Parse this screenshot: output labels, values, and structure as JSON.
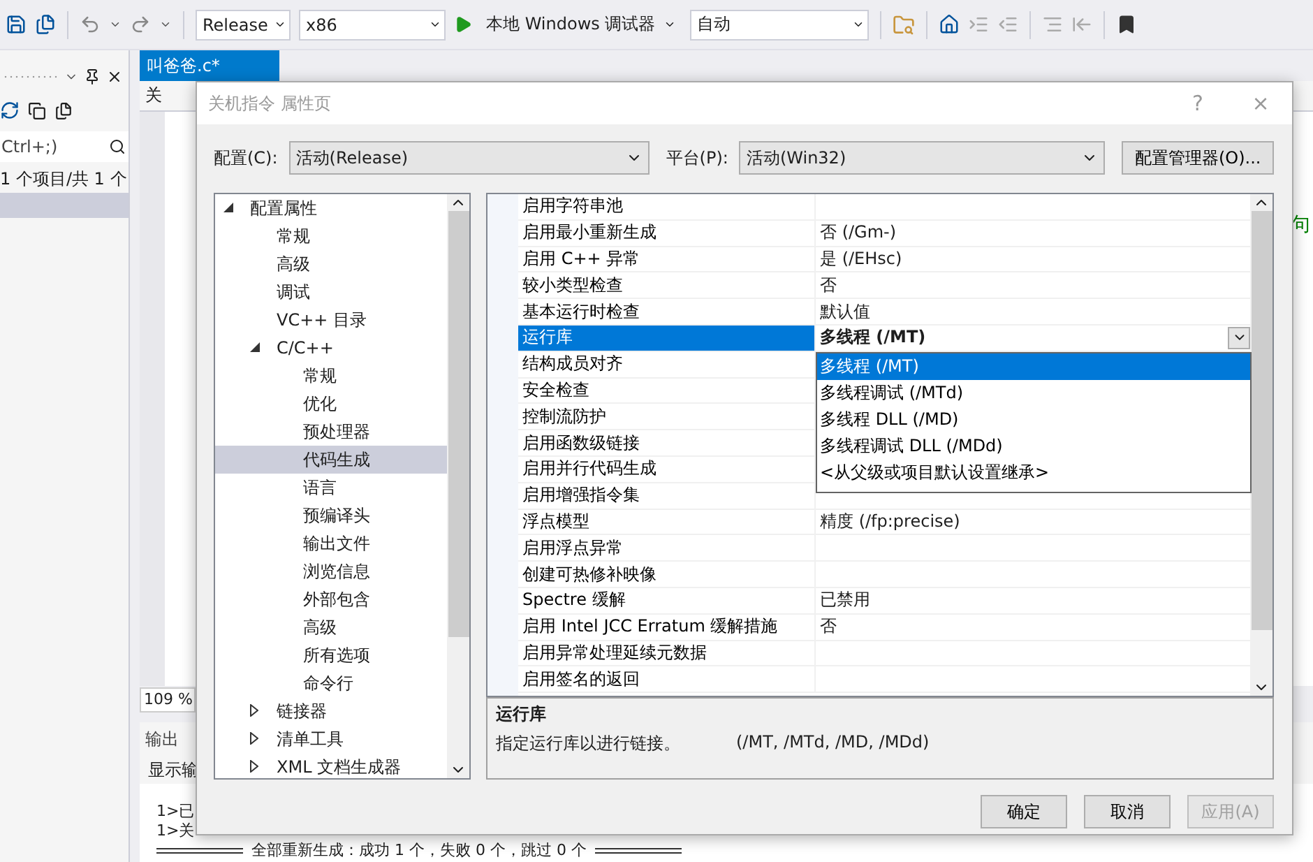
{
  "toolbar": {
    "configuration": "Release",
    "platform": "x86",
    "debugger": "本地 Windows 调试器",
    "target": "自动"
  },
  "solution_explorer": {
    "search_placeholder": "Ctrl+;)",
    "filter_status": "1 个项目/共 1 个"
  },
  "editor": {
    "tab": {
      "title": "叫爸爸.c*",
      "selected": true
    },
    "navigation": "关",
    "zoom": "109 %",
    "side_text": "句"
  },
  "output": {
    "title": "输出",
    "show_output_label": "显示输",
    "lines": [
      "1>已",
      "1>关"
    ],
    "summary": "全部重新生成：成功 1 个，失败 0 个，跳过 0 个"
  },
  "dialog": {
    "title": "关机指令 属性页",
    "help": "?",
    "close": "×",
    "configuration_label": "配置(C):",
    "configuration": "活动(Release)",
    "platform_label": "平台(P):",
    "platform": "活动(Win32)",
    "manager_button": "配置管理器(O)...",
    "tree": [
      {
        "label": "配置属性",
        "expanded": true,
        "selected": false,
        "children": [
          {
            "label": "常规",
            "selected": false
          },
          {
            "label": "高级",
            "selected": false
          },
          {
            "label": "调试",
            "selected": false
          },
          {
            "label": "VC++ 目录",
            "selected": false
          },
          {
            "label": "C/C++",
            "expanded": true,
            "selected": false,
            "children": [
              {
                "label": "常规",
                "selected": false
              },
              {
                "label": "优化",
                "selected": false
              },
              {
                "label": "预处理器",
                "selected": false
              },
              {
                "label": "代码生成",
                "selected": true
              },
              {
                "label": "语言",
                "selected": false
              },
              {
                "label": "预编译头",
                "selected": false
              },
              {
                "label": "输出文件",
                "selected": false
              },
              {
                "label": "浏览信息",
                "selected": false
              },
              {
                "label": "外部包含",
                "selected": false
              },
              {
                "label": "高级",
                "selected": false
              },
              {
                "label": "所有选项",
                "selected": false
              },
              {
                "label": "命令行",
                "selected": false
              }
            ]
          },
          {
            "label": "链接器",
            "expanded": false,
            "selected": false
          },
          {
            "label": "清单工具",
            "expanded": false,
            "selected": false
          },
          {
            "label": "XML 文档生成器",
            "expanded": false,
            "selected": false
          }
        ]
      }
    ],
    "properties": [
      {
        "name": "启用字符串池",
        "selected": false
      },
      {
        "name": "启用最小重新生成",
        "value": "否 (/Gm-)",
        "selected": false
      },
      {
        "name": "启用 C++ 异常",
        "value": "是 (/EHsc)",
        "selected": false
      },
      {
        "name": "较小类型检查",
        "value": "否",
        "selected": false
      },
      {
        "name": "基本运行时检查",
        "value": "默认值",
        "selected": false
      },
      {
        "name": "运行库",
        "value": "多线程 (/MT)",
        "selected": true
      },
      {
        "name": "结构成员对齐",
        "selected": false
      },
      {
        "name": "安全检查",
        "selected": false
      },
      {
        "name": "控制流防护",
        "selected": false
      },
      {
        "name": "启用函数级链接",
        "selected": false
      },
      {
        "name": "启用并行代码生成",
        "selected": false
      },
      {
        "name": "启用增强指令集",
        "selected": false
      },
      {
        "name": "浮点模型",
        "value": "精度 (/fp:precise)",
        "selected": false
      },
      {
        "name": "启用浮点异常",
        "selected": false
      },
      {
        "name": "创建可热修补映像",
        "selected": false
      },
      {
        "name": "Spectre 缓解",
        "value": "已禁用",
        "selected": false
      },
      {
        "name": "启用 Intel JCC Erratum 缓解措施",
        "value": "否",
        "selected": false
      },
      {
        "name": "启用异常处理延续元数据",
        "selected": false
      },
      {
        "name": "启用签名的返回",
        "selected": false
      }
    ],
    "runtime_dropdown": {
      "options": [
        {
          "label": "多线程 (/MT)",
          "selected": true
        },
        {
          "label": "多线程调试 (/MTd)",
          "selected": false
        },
        {
          "label": "多线程 DLL (/MD)",
          "selected": false
        },
        {
          "label": "多线程调试 DLL (/MDd)",
          "selected": false
        },
        {
          "label": "<从父级或项目默认设置继承>",
          "selected": false
        }
      ]
    },
    "description": {
      "title": "运行库",
      "text": "指定运行库以进行链接。",
      "switches": "(/MT, /MTd, /MD, /MDd)"
    },
    "buttons": [
      {
        "label": "确定",
        "disabled": false
      },
      {
        "label": "取消",
        "disabled": false
      },
      {
        "label": "应用(A)",
        "disabled": true
      }
    ]
  }
}
